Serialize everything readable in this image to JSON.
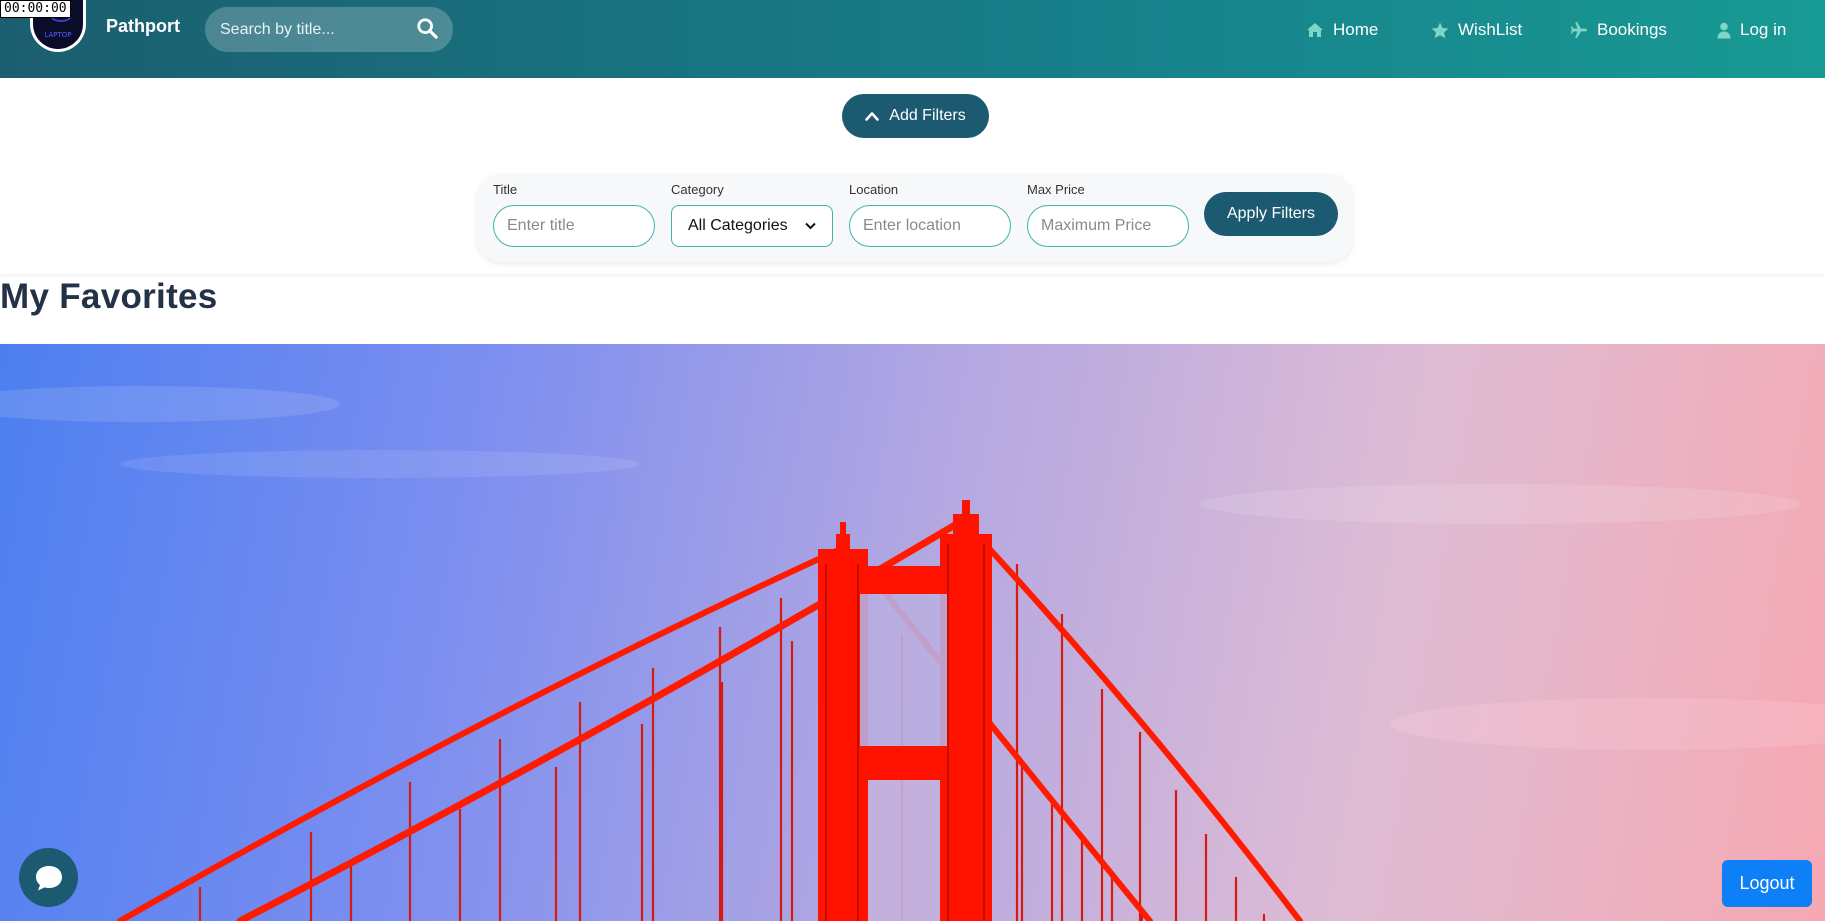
{
  "timer": "00:00:00",
  "brand": {
    "name": "Pathport",
    "logo_text": "LAPTOP"
  },
  "search": {
    "placeholder": "Search by title..."
  },
  "nav": [
    {
      "label": "Home",
      "icon": "home-icon"
    },
    {
      "label": "WishList",
      "icon": "star-icon"
    },
    {
      "label": "Bookings",
      "icon": "plane-icon"
    },
    {
      "label": "Log in",
      "icon": "user-icon"
    }
  ],
  "filters": {
    "toggle_label": "Add Filters",
    "title": {
      "label": "Title",
      "placeholder": "Enter title"
    },
    "category": {
      "label": "Category",
      "selected": "All Categories"
    },
    "location": {
      "label": "Location",
      "placeholder": "Enter location"
    },
    "max_price": {
      "label": "Max Price",
      "placeholder": "Maximum Price"
    },
    "apply_label": "Apply Filters"
  },
  "page_title": "My Favorites",
  "logout_label": "Logout",
  "colors": {
    "header_start": "#1b5e6f",
    "header_end": "#189a94",
    "button_dark": "#1b5a70",
    "input_border": "#3bb6a8",
    "logout_blue": "#0d7ff7",
    "bridge_red": "#ff1a00"
  }
}
